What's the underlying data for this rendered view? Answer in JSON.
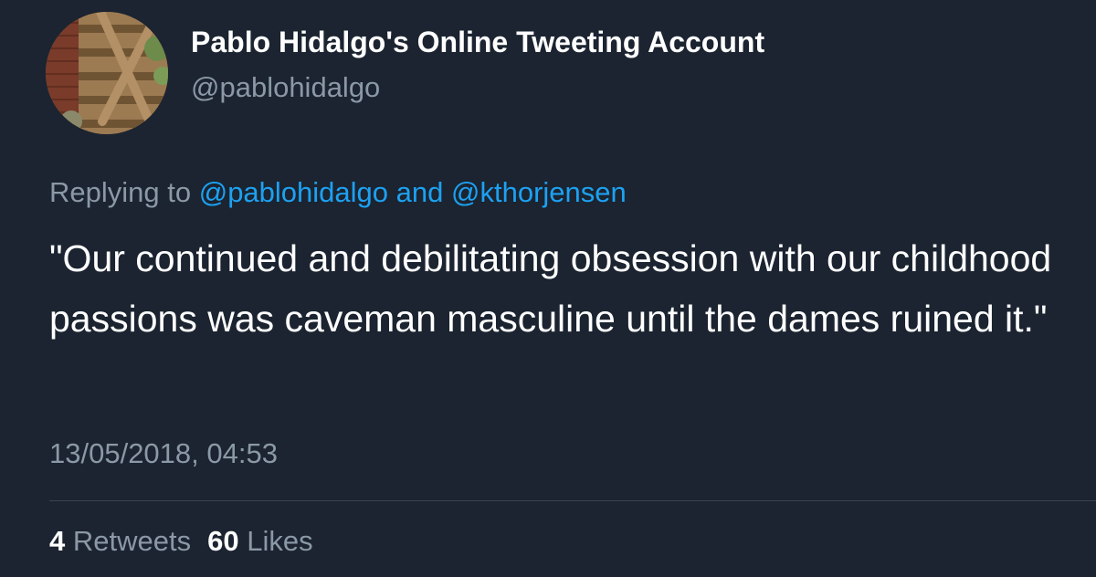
{
  "author": {
    "display_name": "Pablo Hidalgo's Online Tweeting Account",
    "handle": "@pablohidalgo",
    "avatar_icon": "avatar-photo-wooden-fence"
  },
  "reply": {
    "prefix": "Replying to",
    "mention_1": "@pablohidalgo",
    "conjunction": "and",
    "mention_2": "@kthorjensen"
  },
  "tweet": {
    "text": "\"Our continued and debilitating obsession with our childhood passions was caveman masculine until the dames ruined it.\"",
    "timestamp": "13/05/2018, 04:53"
  },
  "stats": {
    "retweets_count": "4",
    "retweets_label": "Retweets",
    "likes_count": "60",
    "likes_label": "Likes"
  },
  "colors": {
    "background": "#1b2430",
    "link": "#1da1f2",
    "muted": "#8b98a6",
    "text": "#ffffff"
  }
}
